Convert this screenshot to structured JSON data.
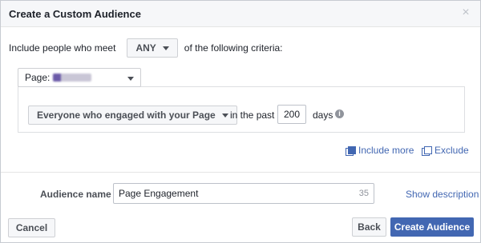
{
  "dialog": {
    "title": "Create a Custom Audience",
    "close_symbol": "×"
  },
  "criteria": {
    "prefix": "Include people who meet",
    "match_value": "ANY",
    "suffix": "of the following criteria:"
  },
  "page_selector": {
    "label": "Page:"
  },
  "rule": {
    "engagement_type": "Everyone who engaged with your Page",
    "in_the_past_label": "in the past",
    "days_value": "200",
    "days_label": "days",
    "info_symbol": "i"
  },
  "links": {
    "include_more": "Include more",
    "exclude": "Exclude",
    "show_description": "Show description"
  },
  "audience": {
    "label": "Audience name",
    "value": "Page Engagement",
    "chars_remaining": "35"
  },
  "footer": {
    "cancel": "Cancel",
    "back": "Back",
    "create": "Create Audience"
  },
  "colors": {
    "primary_blue": "#4267b2",
    "header_bg": "#f6f7f9",
    "border": "#ced0d4"
  },
  "icons": {
    "close": "close-icon",
    "dropdown": "chevron-down-icon",
    "info": "info-icon",
    "include": "include-more-icon",
    "exclude": "exclude-icon"
  }
}
